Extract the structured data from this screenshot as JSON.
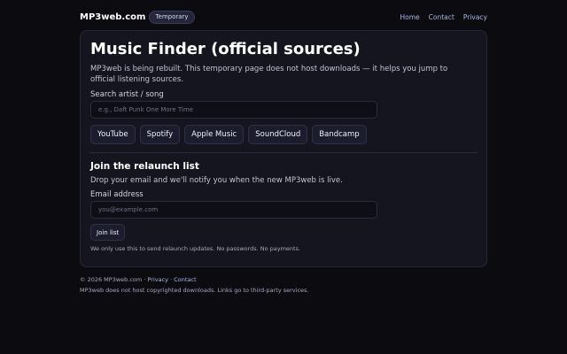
{
  "header": {
    "brand": "MP3web.com",
    "badge": "Temporary",
    "nav": [
      "Home",
      "Contact",
      "Privacy"
    ]
  },
  "finder": {
    "title": "Music Finder (official sources)",
    "intro": "MP3web is being rebuilt. This temporary page does not host downloads — it helps you jump to official listening sources.",
    "search_label": "Search artist / song",
    "search_placeholder": "e.g., Daft Punk One More Time",
    "search_value": "",
    "sources": [
      "YouTube",
      "Spotify",
      "Apple Music",
      "SoundCloud",
      "Bandcamp"
    ]
  },
  "relaunch": {
    "title": "Join the relaunch list",
    "description": "Drop your email and we'll notify you when the new MP3web is live.",
    "email_label": "Email address",
    "email_placeholder": "you@example.com",
    "email_value": "",
    "button": "Join list",
    "note": "We only use this to send relaunch updates. No passwords. No payments."
  },
  "footer": {
    "copyright": "© 2026 MP3web.com",
    "separator": "·",
    "links": [
      "Privacy",
      "Contact"
    ],
    "disclaimer": "MP3web does not host copyrighted downloads. Links go to third-party services."
  }
}
